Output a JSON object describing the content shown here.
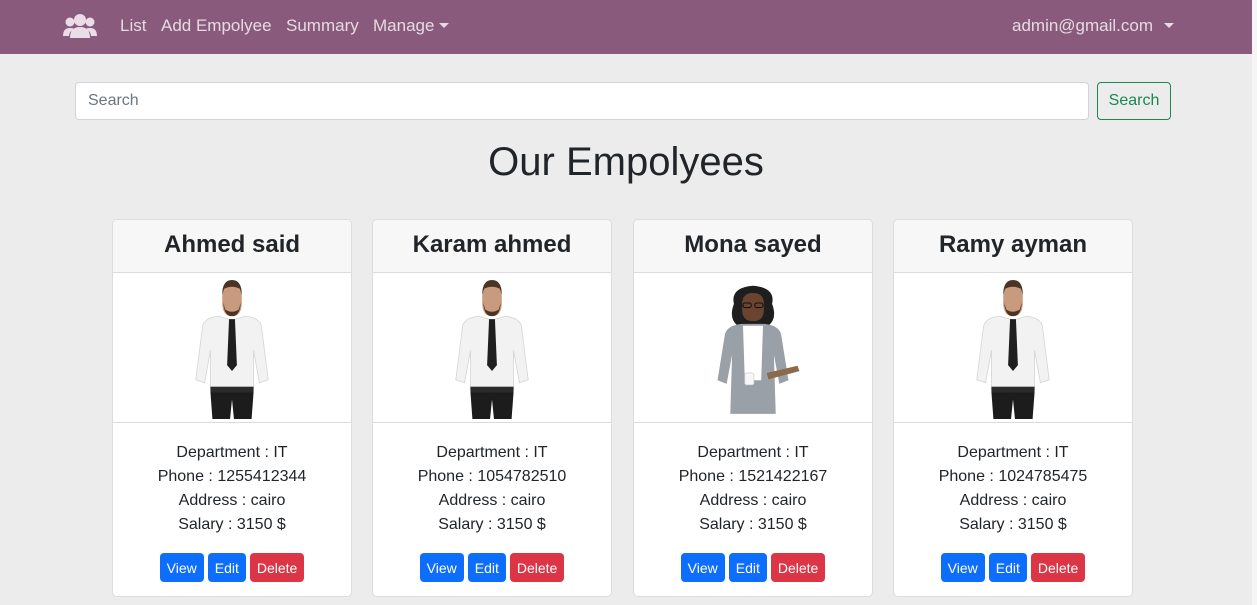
{
  "navbar": {
    "brand_icon": "users-icon",
    "links": [
      "List",
      "Add Empolyee",
      "Summary"
    ],
    "manage_label": "Manage",
    "user_email": "admin@gmail.com",
    "background": "#8a5a7c"
  },
  "search": {
    "placeholder": "Search",
    "value": "",
    "button_label": "Search"
  },
  "page_title": "Our Empolyees",
  "employees": [
    {
      "name": "Ahmed said",
      "photo": "male-employee-photo",
      "department_label": "Department : ",
      "department": "IT",
      "phone_label": "Phone : ",
      "phone": "1255412344",
      "address_label": "Address : ",
      "address": "cairo",
      "salary_label": "Salary : ",
      "salary": "3150 $",
      "view_label": "View",
      "edit_label": "Edit",
      "delete_label": "Delete"
    },
    {
      "name": "Karam ahmed",
      "photo": "male-employee-photo",
      "department_label": "Department : ",
      "department": "IT",
      "phone_label": "Phone : ",
      "phone": "1054782510",
      "address_label": "Address : ",
      "address": "cairo",
      "salary_label": "Salary : ",
      "salary": "3150 $",
      "view_label": "View",
      "edit_label": "Edit",
      "delete_label": "Delete"
    },
    {
      "name": "Mona sayed",
      "photo": "female-employee-photo",
      "department_label": "Department : ",
      "department": "IT",
      "phone_label": "Phone : ",
      "phone": "1521422167",
      "address_label": "Address : ",
      "address": "cairo",
      "salary_label": "Salary : ",
      "salary": "3150 $",
      "view_label": "View",
      "edit_label": "Edit",
      "delete_label": "Delete"
    },
    {
      "name": "Ramy ayman",
      "photo": "male-employee-photo",
      "department_label": "Department : ",
      "department": "IT",
      "phone_label": "Phone : ",
      "phone": "1024785475",
      "address_label": "Address : ",
      "address": "cairo",
      "salary_label": "Salary : ",
      "salary": "3150 $",
      "view_label": "View",
      "edit_label": "Edit",
      "delete_label": "Delete"
    }
  ]
}
